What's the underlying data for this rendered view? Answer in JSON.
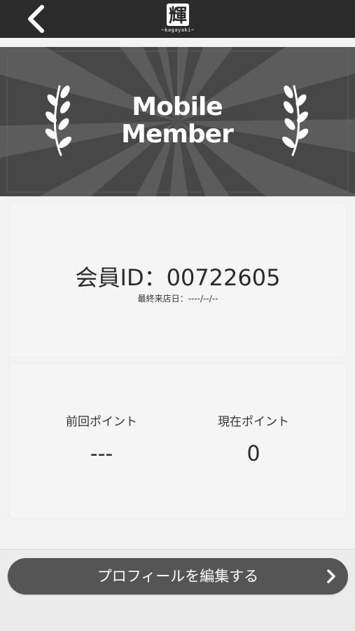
{
  "header": {
    "back_icon": "chevron-left-icon",
    "logo_mark": "輝",
    "logo_sub": "~kagayaki~"
  },
  "banner": {
    "title_line1": "Mobile",
    "title_line2": "Member",
    "decoration_icon": "laurel-icon"
  },
  "member": {
    "id_text": "会員ID：00722605",
    "last_visit_text": "最終来店日：----/--/--"
  },
  "points": {
    "previous_label": "前回ポイント",
    "previous_value": "---",
    "current_label": "現在ポイント",
    "current_value": "0"
  },
  "actions": {
    "edit_profile_label": "プロフィールを編集する",
    "edit_profile_icon": "chevron-right-icon"
  },
  "colors": {
    "header_bg": "#2b2b2b",
    "banner_bg": "#4a4a4a",
    "card_bg": "#f5f5f5",
    "button_bg": "#555555",
    "text_on_dark": "#ffffff"
  }
}
